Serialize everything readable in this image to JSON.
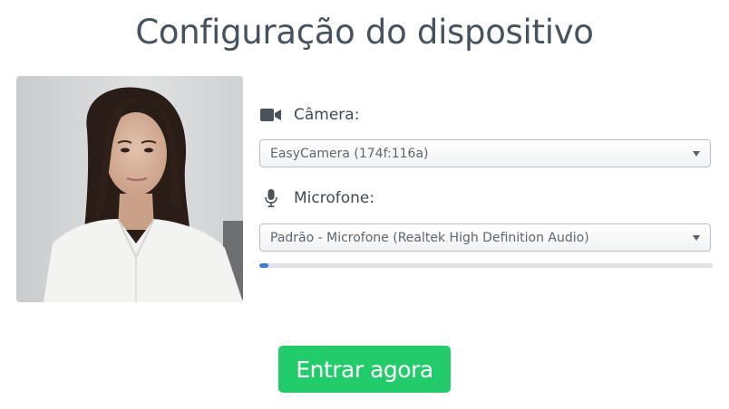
{
  "page": {
    "title": "Configuração do dispositivo"
  },
  "camera": {
    "label": "Câmera:",
    "icon": "video-camera-icon",
    "selected": "EasyCamera (174f:116a)"
  },
  "microphone": {
    "label": "Microfone:",
    "icon": "microphone-icon",
    "selected": "Padrão - Microfone (Realtek High Definition Audio)",
    "level_fraction": 0.02
  },
  "actions": {
    "join_label": "Entrar agora"
  },
  "colors": {
    "title": "#46525e",
    "join_button": "#23cc6a",
    "meter_fill": "#3f7bd1",
    "meter_track": "#dde3e8"
  }
}
